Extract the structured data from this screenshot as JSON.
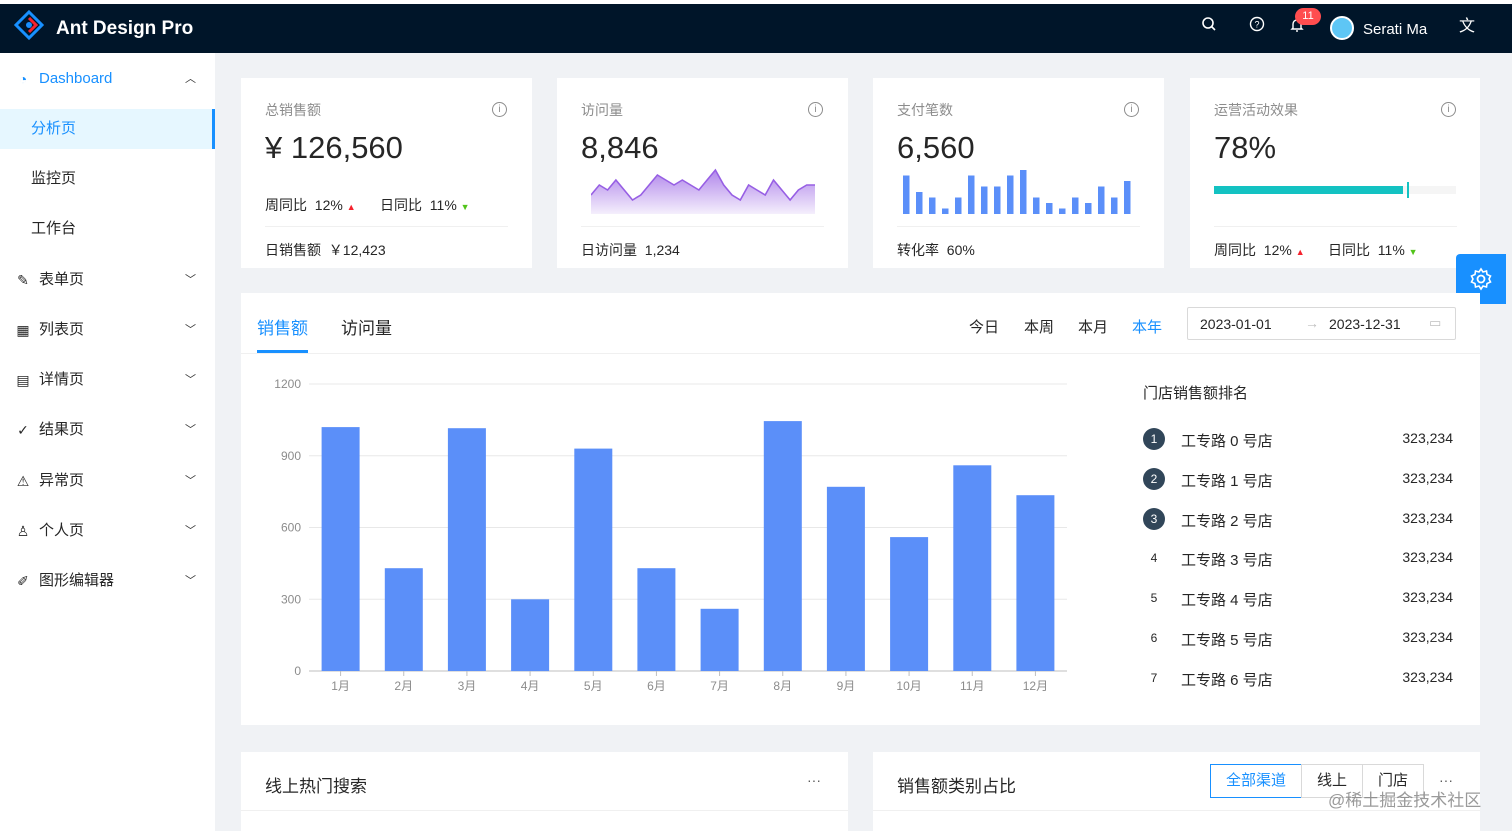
{
  "header": {
    "title": "Ant Design Pro",
    "notification_count": "11",
    "user_name": "Serati Ma"
  },
  "sidebar": {
    "items": [
      {
        "label": "Dashboard",
        "icon": "dashboard-icon"
      },
      {
        "label": "分析页"
      },
      {
        "label": "监控页"
      },
      {
        "label": "工作台"
      },
      {
        "label": "表单页",
        "icon": "form-icon"
      },
      {
        "label": "列表页",
        "icon": "table-icon"
      },
      {
        "label": "详情页",
        "icon": "profile-icon"
      },
      {
        "label": "结果页",
        "icon": "check-circle-icon"
      },
      {
        "label": "异常页",
        "icon": "warning-icon"
      },
      {
        "label": "个人页",
        "icon": "user-icon"
      },
      {
        "label": "图形编辑器",
        "icon": "highlight-icon"
      }
    ]
  },
  "stats": {
    "sales": {
      "title": "总销售额",
      "value": "¥ 126,560",
      "week_label": "周同比",
      "week_value": "12%",
      "day_label": "日同比",
      "day_value": "11%",
      "footer_label": "日销售额",
      "footer_value": "￥12,423"
    },
    "visits": {
      "title": "访问量",
      "value": "8,846",
      "footer_label": "日访问量",
      "footer_value": "1,234",
      "trend": [
        3,
        5,
        4,
        6,
        4,
        2,
        3,
        5,
        7,
        6,
        5,
        6,
        5,
        4,
        6,
        8,
        5,
        3,
        2,
        5,
        4,
        3,
        6,
        4,
        2,
        4,
        5,
        5
      ]
    },
    "payments": {
      "title": "支付笔数",
      "value": "6,560",
      "footer_label": "转化率",
      "footer_value": "60%",
      "bars": [
        7,
        4,
        3,
        1,
        3,
        7,
        5,
        5,
        7,
        8,
        3,
        2,
        1,
        3,
        2,
        5,
        3,
        6
      ]
    },
    "operations": {
      "title": "运营活动效果",
      "value": "78%",
      "progress": 0.78,
      "week_label": "周同比",
      "week_value": "12%",
      "day_label": "日同比",
      "day_value": "11%"
    }
  },
  "sales_panel": {
    "tabs": [
      "销售额",
      "访问量"
    ],
    "ranges": [
      "今日",
      "本周",
      "本月",
      "本年"
    ],
    "active_range": "本年",
    "date_start": "2023-01-01",
    "date_end": "2023-12-31",
    "ranking_title": "门店销售额排名",
    "ranking": [
      {
        "rank": "1",
        "name": "工专路 0 号店",
        "value": "323,234"
      },
      {
        "rank": "2",
        "name": "工专路 1 号店",
        "value": "323,234"
      },
      {
        "rank": "3",
        "name": "工专路 2 号店",
        "value": "323,234"
      },
      {
        "rank": "4",
        "name": "工专路 3 号店",
        "value": "323,234"
      },
      {
        "rank": "5",
        "name": "工专路 4 号店",
        "value": "323,234"
      },
      {
        "rank": "6",
        "name": "工专路 5 号店",
        "value": "323,234"
      },
      {
        "rank": "7",
        "name": "工专路 6 号店",
        "value": "323,234"
      }
    ]
  },
  "chart_data": {
    "type": "bar",
    "categories": [
      "1月",
      "2月",
      "3月",
      "4月",
      "5月",
      "6月",
      "7月",
      "8月",
      "9月",
      "10月",
      "11月",
      "12月"
    ],
    "values": [
      1020,
      430,
      1015,
      300,
      930,
      430,
      260,
      1045,
      770,
      560,
      860,
      735
    ],
    "ylim": [
      0,
      1200
    ],
    "yticks": [
      0,
      300,
      600,
      900,
      1200
    ],
    "grid": true,
    "color": "#5b8ff9"
  },
  "bottom": {
    "search_title": "线上热门搜索",
    "more": "···",
    "category_title": "销售额类别占比",
    "channels": [
      "全部渠道",
      "线上",
      "门店"
    ]
  },
  "watermark": "@稀土掘金技术社区",
  "colors": {
    "primary": "#1890ff",
    "header_bg": "#001529",
    "progress": "#13c2c2",
    "area": "#975fe4",
    "bars": "#5b8ff9"
  }
}
